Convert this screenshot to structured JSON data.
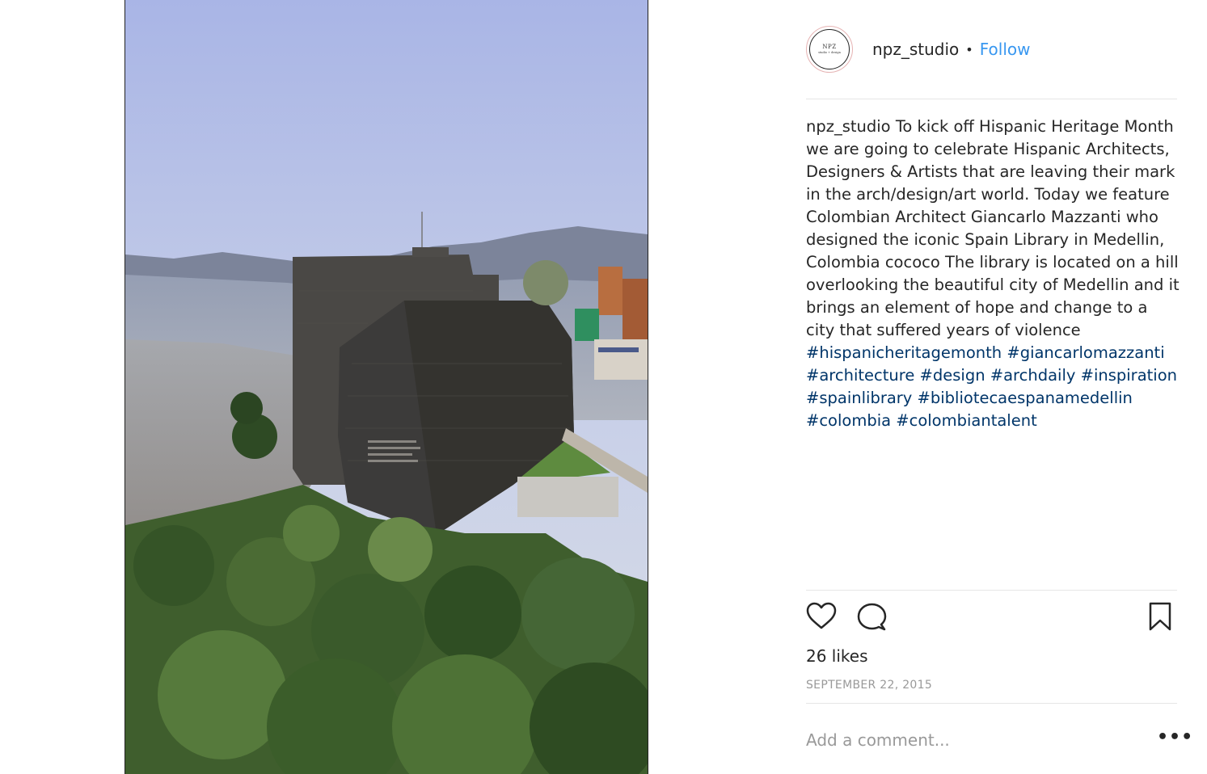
{
  "post": {
    "image_alt": "Spain Library in Medellin, Colombia",
    "header": {
      "username": "npz_studio",
      "separator": "•",
      "follow_label": "Follow"
    },
    "avatar": {
      "logo_line1": "NPZ",
      "logo_line2": "studio + design"
    },
    "caption": {
      "username": "npz_studio",
      "text": "To kick off Hispanic Heritage Month we are going to celebrate Hispanic Architects, Designers & Artists that are leaving their mark in the arch/design/art world. Today we feature Colombian Architect Giancarlo Mazzanti who designed the iconic Spain Library in Medellin, Colombia cococo The library is located on a hill overlooking the beautiful city of Medellin and it brings an element of hope and change to a city that suffered years of violence",
      "hashtags": "#hispanicheritagemonth #giancarlomazzanti #architecture #design #archdaily #inspiration #spainlibrary #bibliotecaespanamedellin #colombia #colombiantalent"
    },
    "actions": {
      "like_icon": "heart-icon",
      "comment_icon": "comment-icon",
      "save_icon": "bookmark-icon"
    },
    "likes": "26 likes",
    "date": "SEPTEMBER 22, 2015",
    "comment_placeholder": "Add a comment...",
    "more_label": "•••"
  },
  "colors": {
    "follow": "#3897f0",
    "hashtag": "#003569",
    "muted": "#999999",
    "text": "#262626"
  }
}
